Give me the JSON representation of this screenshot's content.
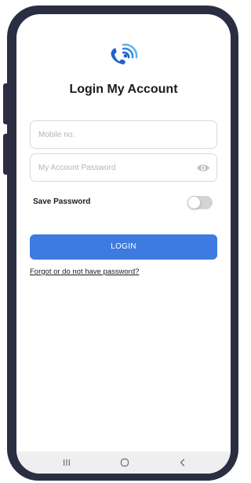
{
  "app": {
    "title": "Login My Account",
    "accent_color": "#3e7be0",
    "logo_icon": "wifi-call-logo-icon"
  },
  "form": {
    "mobile": {
      "value": "",
      "placeholder": "Mobile no."
    },
    "password": {
      "value": "",
      "placeholder": "My Account Password",
      "visibility_icon": "eye-icon"
    },
    "save_password": {
      "label": "Save Password",
      "enabled": false
    },
    "login_label": "LOGIN",
    "forgot_link": "Forgot or do not have password?"
  },
  "navigation_bar": {
    "icons": [
      "recent-apps-icon",
      "home-icon",
      "back-icon"
    ]
  }
}
